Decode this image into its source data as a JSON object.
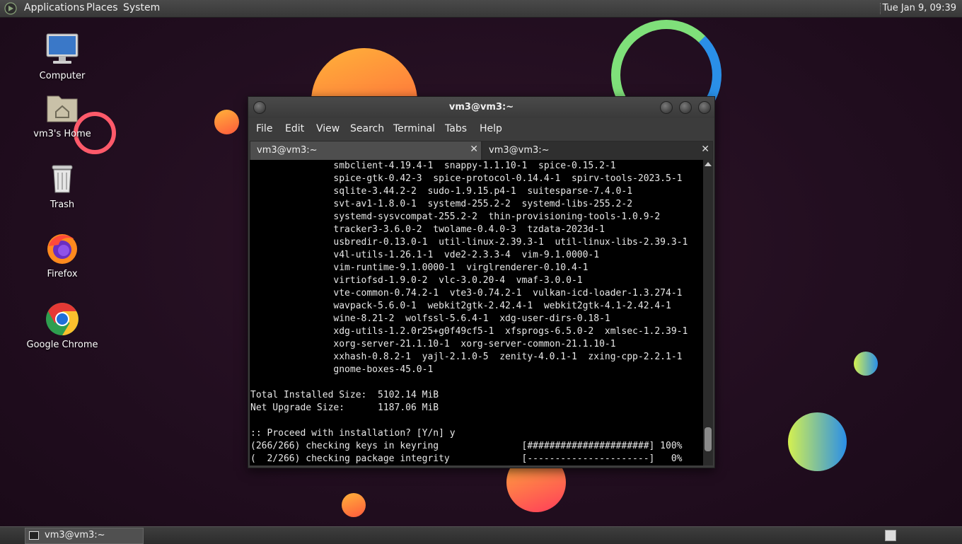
{
  "top_panel": {
    "menus": [
      "Applications",
      "Places",
      "System"
    ],
    "clock": "Tue Jan  9, 09:39"
  },
  "desktop": {
    "icons": [
      {
        "label": "Computer",
        "icon": "computer-icon"
      },
      {
        "label": "vm3's Home",
        "icon": "home-folder-icon"
      },
      {
        "label": "Trash",
        "icon": "trash-icon"
      },
      {
        "label": "Firefox",
        "icon": "firefox-icon"
      },
      {
        "label": "Google Chrome",
        "icon": "chrome-icon"
      }
    ]
  },
  "window": {
    "title": "vm3@vm3:~",
    "menu": [
      "File",
      "Edit",
      "View",
      "Search",
      "Terminal",
      "Tabs",
      "Help"
    ],
    "tabs": [
      {
        "label": "vm3@vm3:~",
        "active": true
      },
      {
        "label": "vm3@vm3:~",
        "active": false
      }
    ],
    "terminal_lines": [
      "               smbclient-4.19.4-1  snappy-1.1.10-1  spice-0.15.2-1",
      "               spice-gtk-0.42-3  spice-protocol-0.14.4-1  spirv-tools-2023.5-1",
      "               sqlite-3.44.2-2  sudo-1.9.15.p4-1  suitesparse-7.4.0-1",
      "               svt-av1-1.8.0-1  systemd-255.2-2  systemd-libs-255.2-2",
      "               systemd-sysvcompat-255.2-2  thin-provisioning-tools-1.0.9-2",
      "               tracker3-3.6.0-2  twolame-0.4.0-3  tzdata-2023d-1",
      "               usbredir-0.13.0-1  util-linux-2.39.3-1  util-linux-libs-2.39.3-1",
      "               v4l-utils-1.26.1-1  vde2-2.3.3-4  vim-9.1.0000-1",
      "               vim-runtime-9.1.0000-1  virglrenderer-0.10.4-1",
      "               virtiofsd-1.9.0-2  vlc-3.0.20-4  vmaf-3.0.0-1",
      "               vte-common-0.74.2-1  vte3-0.74.2-1  vulkan-icd-loader-1.3.274-1",
      "               wavpack-5.6.0-1  webkit2gtk-2.42.4-1  webkit2gtk-4.1-2.42.4-1",
      "               wine-8.21-2  wolfssl-5.6.4-1  xdg-user-dirs-0.18-1",
      "               xdg-utils-1.2.0r25+g0f49cf5-1  xfsprogs-6.5.0-2  xmlsec-1.2.39-1",
      "               xorg-server-21.1.10-1  xorg-server-common-21.1.10-1",
      "               xxhash-0.8.2-1  yajl-2.1.0-5  zenity-4.0.1-1  zxing-cpp-2.2.1-1",
      "               gnome-boxes-45.0-1",
      "",
      "Total Installed Size:  5102.14 MiB",
      "Net Upgrade Size:      1187.06 MiB",
      "",
      ":: Proceed with installation? [Y/n] y",
      "(266/266) checking keys in keyring               [######################] 100%",
      "(  2/266) checking package integrity             [----------------------]   0%"
    ]
  },
  "taskbar": {
    "items": [
      {
        "label": "vm3@vm3:~",
        "icon": "terminal-icon"
      }
    ]
  },
  "colors": {
    "desktop_bg": "#220e20",
    "panel_bg": "#3e3e3e",
    "terminal_bg": "#000000",
    "terminal_fg": "#e8e8e8"
  }
}
